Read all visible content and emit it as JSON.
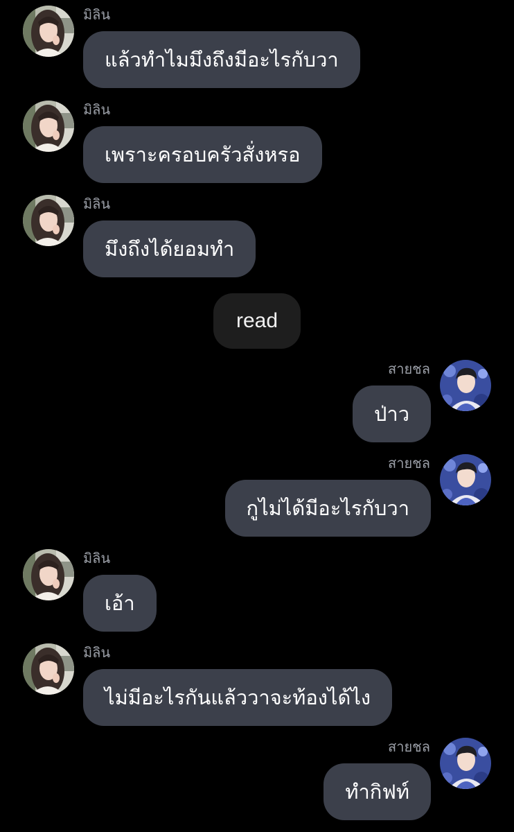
{
  "contacts": {
    "milin": {
      "name": "มิลิน",
      "avatar_icon": "girl-profile-avatar"
    },
    "saichon": {
      "name": "สายชล",
      "avatar_icon": "boy-profile-avatar"
    }
  },
  "messages": [
    {
      "from": "milin",
      "direction": "incoming",
      "sender": "มิลิน",
      "text": "แล้วทำไมมึงถึงมีอะไรกับวา"
    },
    {
      "from": "milin",
      "direction": "incoming",
      "sender": "มิลิน",
      "text": "เพราะครอบครัวสั่งหรอ"
    },
    {
      "from": "milin",
      "direction": "incoming",
      "sender": "มิลิน",
      "text": "มึงถึงได้ยอมทำ"
    },
    {
      "from": "saichon",
      "direction": "outgoing",
      "sender": "สายชล",
      "text": "ป่าว"
    },
    {
      "from": "saichon",
      "direction": "outgoing",
      "sender": "สายชล",
      "text": "กูไม่ได้มีอะไรกับวา"
    },
    {
      "from": "milin",
      "direction": "incoming",
      "sender": "มิลิน",
      "text": "เอ้า"
    },
    {
      "from": "milin",
      "direction": "incoming",
      "sender": "มิลิน",
      "text": "ไม่มีอะไรกันแล้ววาจะท้องได้ไง"
    },
    {
      "from": "saichon",
      "direction": "outgoing",
      "sender": "สายชล",
      "text": "ทำกิฟท์"
    }
  ],
  "read_status": "read",
  "colors": {
    "background": "#000000",
    "bubble": "#3c404b",
    "read_pill": "#1e1e1e",
    "sender_name": "#9a9ea6",
    "text": "#ffffff"
  }
}
